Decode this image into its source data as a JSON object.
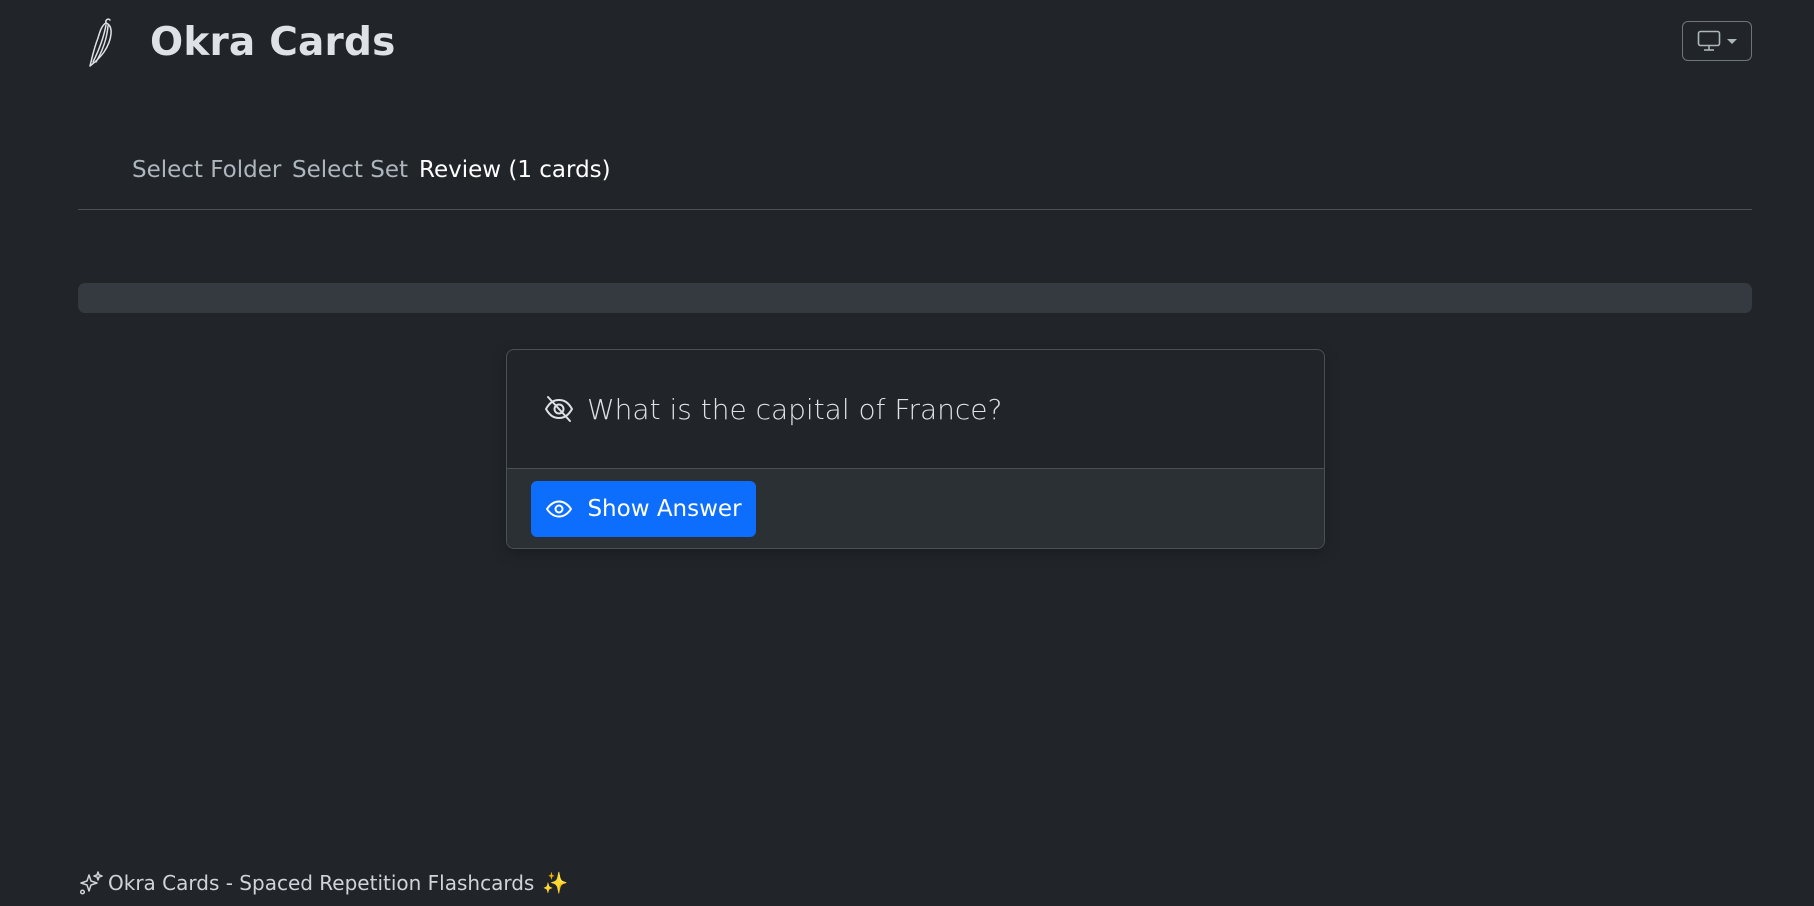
{
  "header": {
    "app_title": "Okra Cards",
    "logo_icon": "okra-pepper-icon",
    "theme_toggle_icon": "monitor-icon"
  },
  "tabs": [
    {
      "label": "Select Folder",
      "active": false
    },
    {
      "label": "Select Set",
      "active": false
    },
    {
      "label": "Review (1 cards)",
      "active": true
    }
  ],
  "progress": {
    "value_percent": 0
  },
  "card": {
    "question_icon": "eye-slash-icon",
    "question": "What is the capital of France?",
    "show_answer_label": "Show Answer",
    "show_answer_icon": "eye-icon"
  },
  "footer": {
    "text": "Okra Cards - Spaced Repetition Flashcards",
    "trailing_emoji": "✨",
    "leading_icon": "stars-icon"
  },
  "colors": {
    "background": "#212529",
    "accent": "#0d6efd",
    "border": "#495057"
  }
}
